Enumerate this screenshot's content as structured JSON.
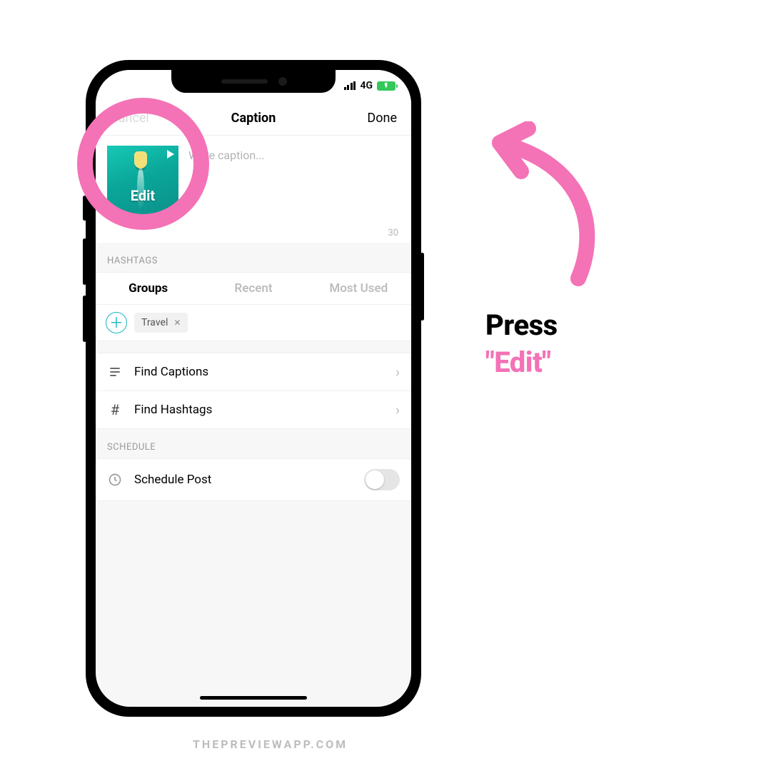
{
  "status_bar": {
    "network": "4G"
  },
  "nav": {
    "cancel": "Cancel",
    "title": "Caption",
    "done": "Done"
  },
  "caption": {
    "placeholder": "Write caption...",
    "counter": "30",
    "thumb_label": "Edit"
  },
  "hashtags": {
    "header": "HASHTAGS",
    "tabs": {
      "groups": "Groups",
      "recent": "Recent",
      "most_used": "Most Used"
    },
    "chip": "Travel"
  },
  "rows": {
    "find_captions": "Find Captions",
    "find_hashtags": "Find Hashtags"
  },
  "schedule": {
    "header": "SCHEDULE",
    "label": "Schedule Post"
  },
  "instruction": {
    "line1": "Press",
    "line2": "\"Edit\""
  },
  "watermark": "THEPREVIEWAPP.COM",
  "colors": {
    "accent_pink": "#f472b6",
    "teal": "#16b7c2"
  }
}
